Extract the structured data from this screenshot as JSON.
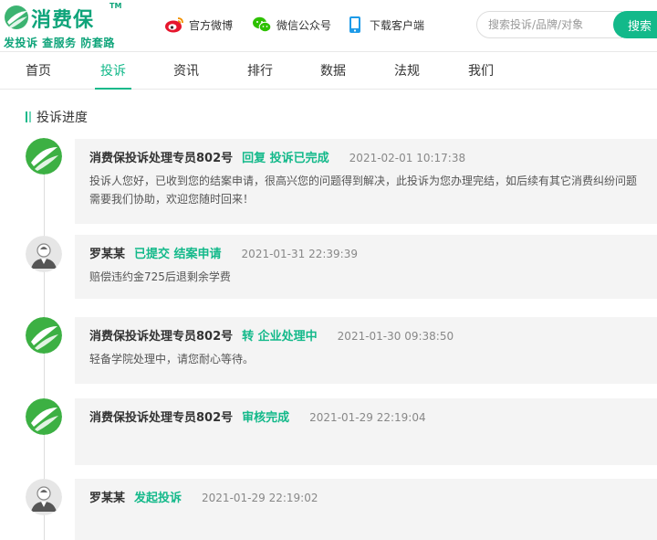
{
  "brand": {
    "name": "消费保",
    "tm": "TM",
    "slogan": "发投诉 查服务 防套路",
    "color": "#0fa47a"
  },
  "top_links": [
    {
      "label": "官方微博",
      "icon": "weibo-icon"
    },
    {
      "label": "微信公众号",
      "icon": "wechat-icon"
    },
    {
      "label": "下载客户端",
      "icon": "mobile-icon"
    }
  ],
  "search": {
    "placeholder": "搜索投诉/品牌/对象",
    "button_label": "搜索"
  },
  "nav": {
    "items": [
      "首页",
      "投诉",
      "资讯",
      "排行",
      "数据",
      "法规",
      "我们"
    ],
    "active": "投诉",
    "accent": "#13b98a"
  },
  "progress": {
    "title": "投诉进度",
    "entries": [
      {
        "avatar": "brand-logo",
        "who": "消费保投诉处理专员802号",
        "action": "回复 投诉已完成",
        "time": "2021-02-01 10:17:38",
        "desc": "投诉人您好，已收到您的结案申请，很高兴您的问题得到解决，此投诉为您办理完结，如后续有其它消费纠纷问题需要我们协助，欢迎您随时回来！"
      },
      {
        "avatar": "user-default",
        "who": "罗某某",
        "action": "已提交 结案申请",
        "time": "2021-01-31 22:39:39",
        "desc": "赔偿违约金725后退剩余学费"
      },
      {
        "avatar": "brand-logo",
        "who": "消费保投诉处理专员802号",
        "action": "转 企业处理中",
        "time": "2021-01-30 09:38:50",
        "desc": "轻备学院处理中，请您耐心等待。"
      },
      {
        "avatar": "brand-logo",
        "who": "消费保投诉处理专员802号",
        "action": "审核完成",
        "time": "2021-01-29 22:19:04",
        "desc": ""
      },
      {
        "avatar": "user-default",
        "who": "罗某某",
        "action": "发起投诉",
        "time": "2021-01-29 22:19:02",
        "desc": ""
      }
    ]
  }
}
